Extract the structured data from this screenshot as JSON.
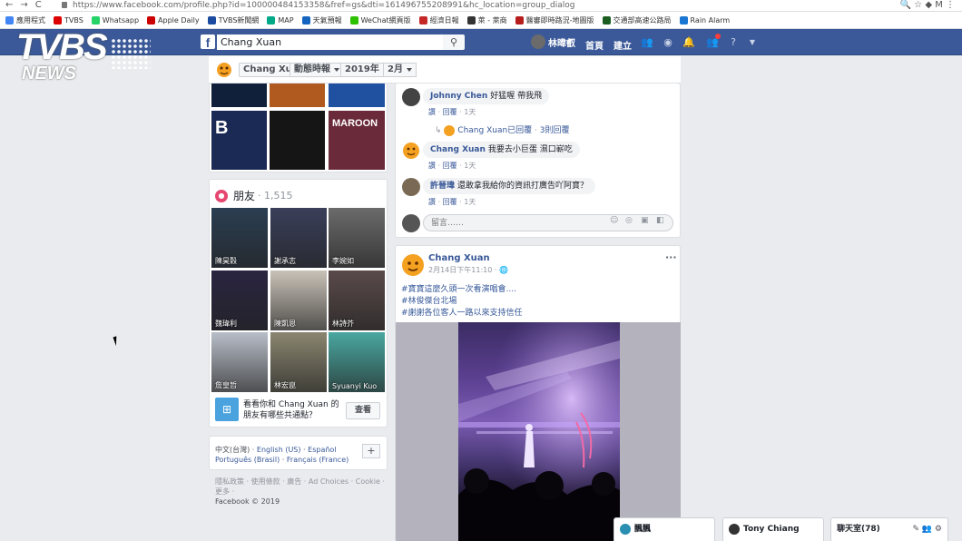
{
  "browser": {
    "url": "https://www.facebook.com/profile.php?id=100000484153358&fref=gs&dti=161496755208991&hc_location=group_dialog",
    "bookmarks": [
      "應用程式",
      "TVBS",
      "Whatsapp",
      "Apple Daily",
      "TVBS新聞網",
      "MAP",
      "天氣預報",
      "WeChat網頁版",
      "經濟日報",
      "萊 - 萊商",
      "醫審即時路況-地圖版",
      "交通部高速公路局",
      "Rain Alarm"
    ]
  },
  "watermark": {
    "brand": "TVBS",
    "sub": "NEWS"
  },
  "fb_header": {
    "logo": "f",
    "search_value": "Chang Xuan",
    "user_name": "林暐叡",
    "nav_home": "首頁",
    "nav_create": "建立"
  },
  "subheader": {
    "name": "Chang Xuan",
    "feed": "動態時報",
    "year": "2019年",
    "month": "2月"
  },
  "photos": [
    {
      "color": "#10203a"
    },
    {
      "color": "#b05a20"
    },
    {
      "color": "#2050a0"
    },
    {
      "color": "#1a2a55",
      "text": "B"
    },
    {
      "color": "#151515",
      "text": ""
    },
    {
      "color": "#6a2a3a",
      "text": "MAROON"
    }
  ],
  "friends": {
    "title": "朋友",
    "count": "1,515",
    "items": [
      {
        "name": "陳昊穀",
        "color": "#2b3e52"
      },
      {
        "name": "謝承志",
        "color": "#3a3f5a"
      },
      {
        "name": "李婉如",
        "color": "#6b6b6b"
      },
      {
        "name": "魏瑋利",
        "color": "#2a2540"
      },
      {
        "name": "陳凱恩",
        "color": "#c9c2b8"
      },
      {
        "name": "林詩芥",
        "color": "#5a4a4a"
      },
      {
        "name": "詹皇哲",
        "color": "#b8bec8"
      },
      {
        "name": "林宏崑",
        "color": "#8a8670"
      },
      {
        "name": "Syuanyi Kuo",
        "color": "#4aa7a0"
      }
    ],
    "suggest_text": "看看你和 Chang Xuan 的朋友有哪些共通點？",
    "suggest_button": "查看"
  },
  "languages": {
    "line1": [
      "中文(台灣)",
      "English (US)",
      "Español"
    ],
    "line2": [
      "Português (Brasil)",
      "Français (France)"
    ],
    "plus": "+"
  },
  "footer": {
    "links": "隱私政策 · 使用條款 · 廣告 · Ad Choices · Cookie · 更多 ·",
    "copyright": "Facebook © 2019"
  },
  "comments": [
    {
      "name": "Johnny Chen",
      "text": "好猛喔 帶我飛",
      "like": "讚",
      "reply": "回覆",
      "time": "1天"
    },
    {
      "replied_by": "Chang Xuan已回覆",
      "reply_count": "3則回覆"
    },
    {
      "name": "Chang Xuan",
      "text": "我要去小巨蛋 濕口嶄吃",
      "like": "讚",
      "reply": "回覆",
      "time": "1天"
    },
    {
      "name": "許晉瑋",
      "text": "還敢拿我給你的資訊打廣告吖阿寶？",
      "like": "讚",
      "reply": "回覆",
      "time": "1天"
    }
  ],
  "comment_input": {
    "placeholder": "留言……"
  },
  "post": {
    "author": "Chang Xuan",
    "time": "2月14日下午11:10 · ",
    "more": "···",
    "tags": [
      "#寶寶這麼久頭一次看演唱會....",
      "#林俊傑台北場",
      "#謝謝各位客人一路以來支持信任"
    ]
  },
  "chat_tabs": [
    {
      "label": "飄飄"
    },
    {
      "label": "Tony Chiang"
    },
    {
      "label": "聊天室(78)"
    }
  ]
}
